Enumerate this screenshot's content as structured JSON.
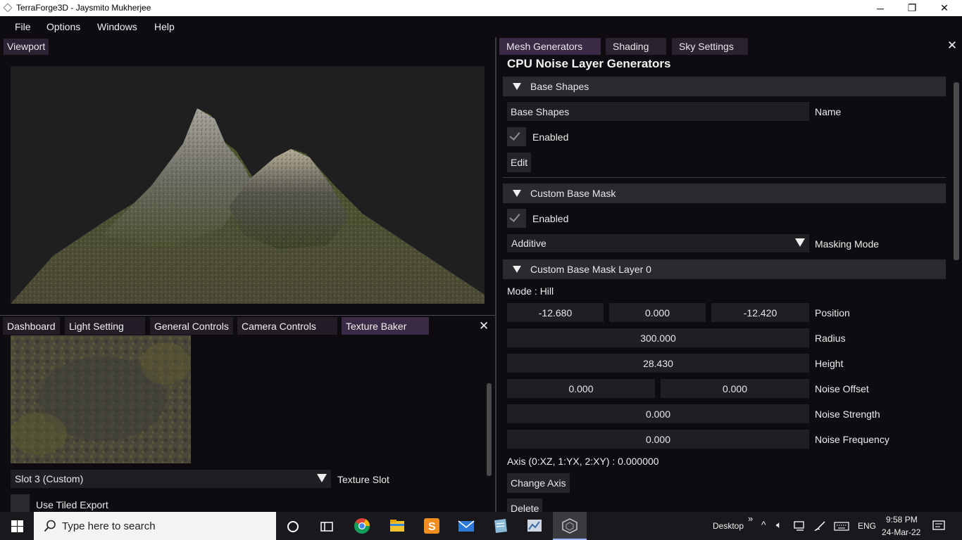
{
  "window": {
    "title": "TerraForge3D - Jaysmito Mukherjee",
    "minimize": "─",
    "maximize": "❐",
    "close": "✕"
  },
  "menu": [
    "File",
    "Options",
    "Windows",
    "Help"
  ],
  "viewport": {
    "tab": "Viewport"
  },
  "bottom_panel": {
    "tabs": [
      "Dashboard",
      "Light Setting",
      "General Controls",
      "Camera Controls",
      "Texture Baker"
    ],
    "close": "✕",
    "texture_slot_value": "Slot 3 (Custom)",
    "texture_slot_label": "Texture Slot",
    "use_tiled_export": "Use Tiled Export"
  },
  "right_panel": {
    "tabs": [
      "Mesh Generators",
      "Shading",
      "Sky Settings"
    ],
    "close": "✕",
    "heading": "CPU Noise Layer Generators",
    "base_shapes": {
      "header": "Base Shapes",
      "name_value": "Base Shapes",
      "name_label": "Name",
      "enabled": "Enabled",
      "edit": "Edit"
    },
    "custom_base_mask": {
      "header": "Custom Base Mask",
      "enabled": "Enabled",
      "masking_mode_value": "Additive",
      "masking_mode_label": "Masking Mode"
    },
    "mask_layer": {
      "header": "Custom Base Mask Layer 0",
      "mode": "Mode : Hill",
      "position": [
        "-12.680",
        "0.000",
        "-12.420"
      ],
      "position_label": "Position",
      "radius": "300.000",
      "radius_label": "Radius",
      "height": "28.430",
      "height_label": "Height",
      "noise_offset": [
        "0.000",
        "0.000"
      ],
      "noise_offset_label": "Noise Offset",
      "noise_strength": "0.000",
      "noise_strength_label": "Noise Strength",
      "noise_frequency": "0.000",
      "noise_frequency_label": "Noise Frequency",
      "axis_text": "Axis (0:XZ, 1:YX, 2:XY) : 0.000000",
      "change_axis": "Change Axis",
      "delete": "Delete"
    }
  },
  "taskbar": {
    "search_placeholder": "Type here to search",
    "desktop": "Desktop",
    "chevron": "»",
    "language": "ENG",
    "time": "9:58 PM",
    "date": "24-Mar-22"
  }
}
